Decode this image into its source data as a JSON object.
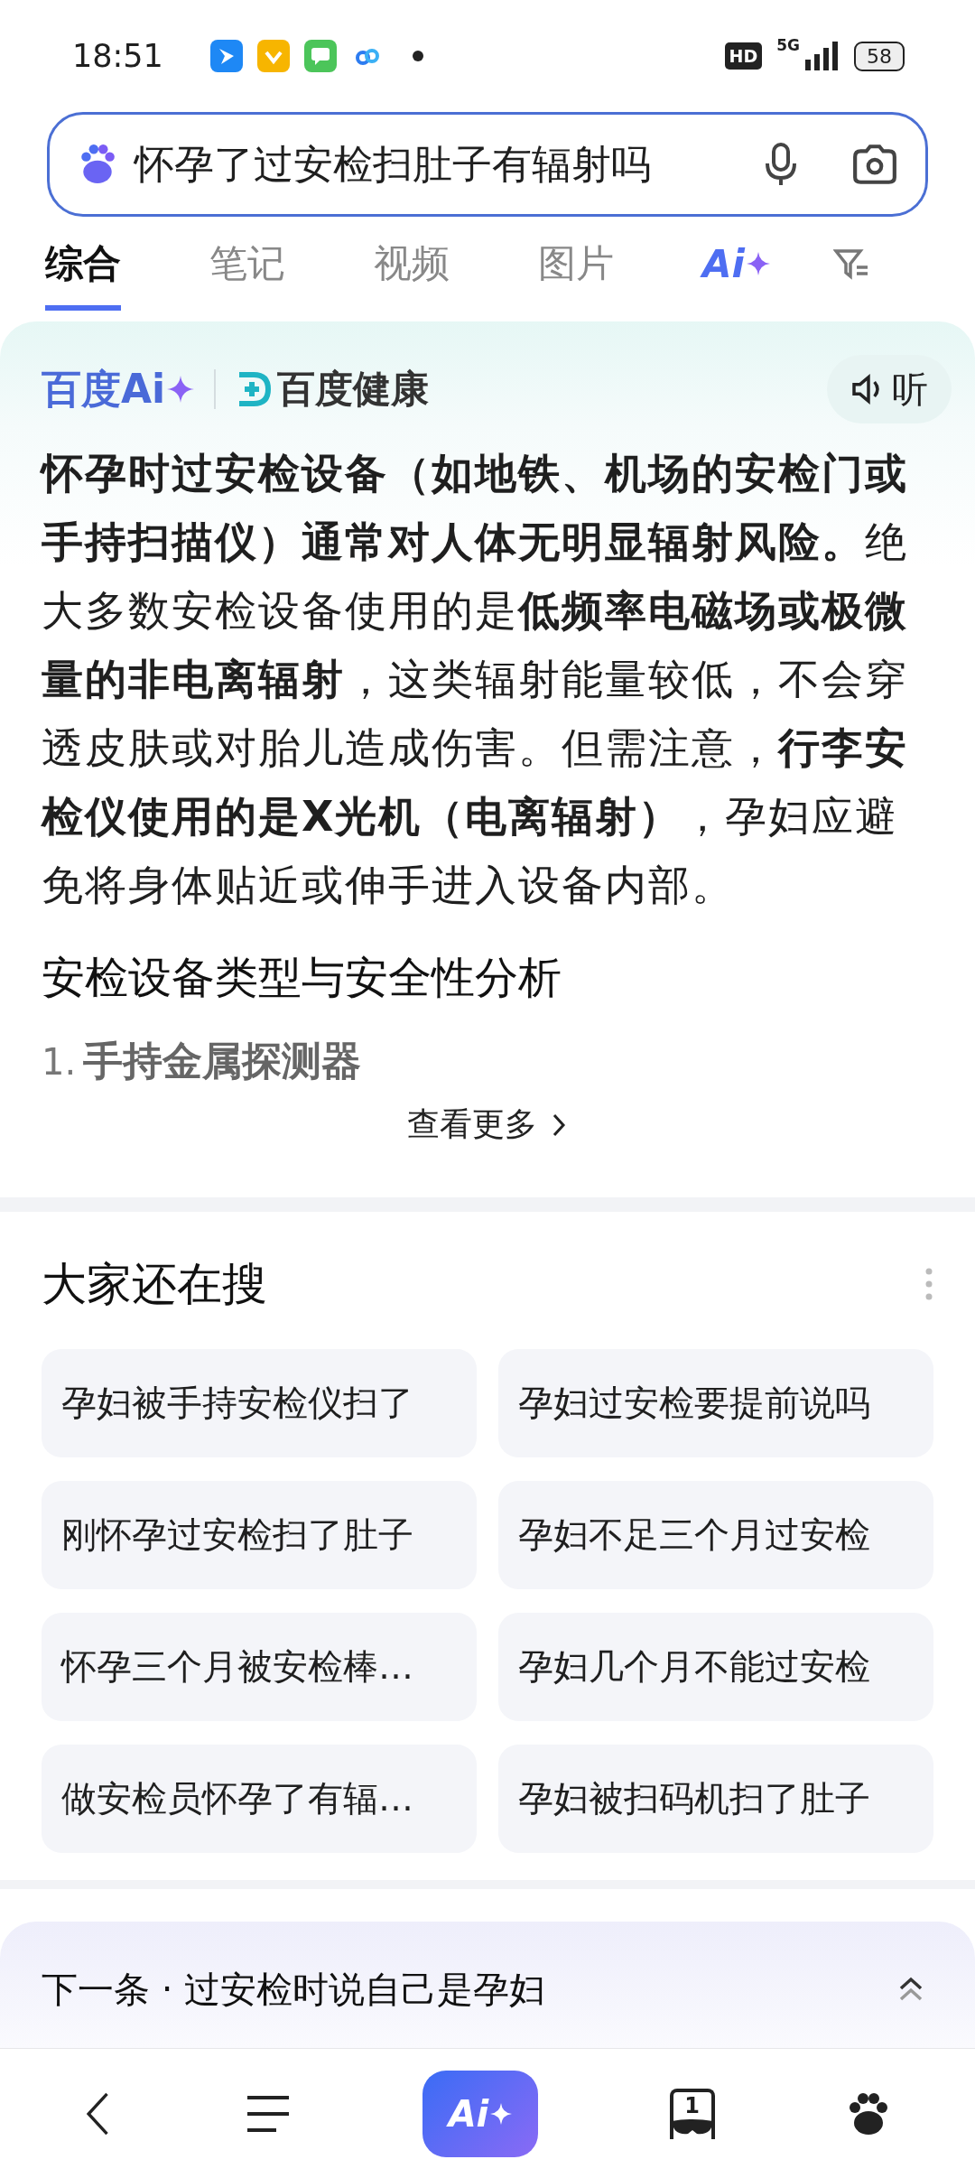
{
  "status_bar": {
    "time": "18:51",
    "hd": "HD",
    "network": "5G",
    "battery": "58"
  },
  "search": {
    "value": "怀孕了过安检扫肚子有辐射吗"
  },
  "tabs": [
    {
      "label": "综合",
      "kind": "text",
      "selected": true
    },
    {
      "label": "笔记",
      "kind": "text",
      "selected": false
    },
    {
      "label": "视频",
      "kind": "text",
      "selected": false
    },
    {
      "label": "图片",
      "kind": "text",
      "selected": false
    },
    {
      "label": "Ai",
      "kind": "ai",
      "selected": false
    },
    {
      "kind": "filter",
      "selected": false
    }
  ],
  "ai_card": {
    "brand": "百度Ai",
    "partner": "百度健康",
    "listen_button": "听",
    "answer": "**怀孕时过安检设备（如地铁、机场的安检门或手持扫描仪）通常对人体无明显辐射风险。**绝大多数安检设备使用的是**低频率电磁场或极微量的非电离辐射**，这类辐射能量较低，不会穿透皮肤或对胎儿造成伤害。但需注意，**行李安检仪使用的是X光机（电离辐射）**，孕妇应避免将身体贴近或伸手进入设备内部。",
    "heading": "安检设备类型与安全性分析",
    "faded_item": {
      "number": "1.",
      "text": "手持金属探测器"
    },
    "more_link": "查看更多"
  },
  "related": {
    "title": "大家还在搜",
    "items": [
      "孕妇被手持安检仪扫了",
      "孕妇过安检要提前说吗",
      "刚怀孕过安检扫了肚子",
      "孕妇不足三个月过安检",
      "怀孕三个月被安检棒…",
      "孕妇几个月不能过安检",
      "做安检员怀孕了有辐…",
      "孕妇被扫码机扫了肚子"
    ]
  },
  "next_bar": {
    "text": "下一条 · 过安检时说自己是孕妇"
  },
  "bottom_nav": {
    "tab_count": "1",
    "ai_label": "Ai"
  }
}
